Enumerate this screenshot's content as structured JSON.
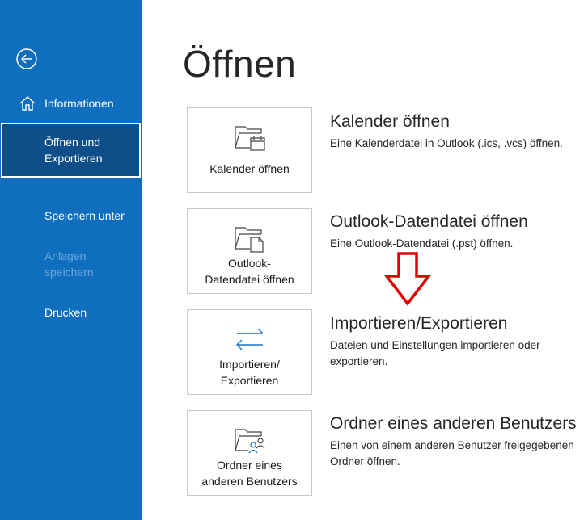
{
  "sidebar": {
    "back_icon": "back-arrow-icon",
    "items": [
      {
        "label": "Informationen",
        "icon": "home-icon"
      },
      {
        "label": "Öffnen und Exportieren",
        "line1": "Öffnen und",
        "line2": "Exportieren",
        "selected": true
      },
      {
        "label": "Speichern unter"
      },
      {
        "label": "Anlagen speichern",
        "line1": "Anlagen",
        "line2": "speichern",
        "disabled": true
      },
      {
        "label": "Drucken"
      }
    ],
    "colors": {
      "background": "#106ebe",
      "selected": "#0e4f8a",
      "disabled_text": "#6aa6de"
    }
  },
  "page": {
    "title": "Öffnen"
  },
  "tiles": [
    {
      "label_line1": "Kalender öffnen",
      "label_line2": "",
      "icon": "calendar-folder-icon",
      "heading": "Kalender öffnen",
      "description": "Eine Kalenderdatei in Outlook (.ics, .vcs) öffnen."
    },
    {
      "label_line1": "Outlook-",
      "label_line2": "Datendatei öffnen",
      "icon": "data-file-folder-icon",
      "heading": "Outlook-Datendatei öffnen",
      "description": "Eine Outlook-Datendatei (.pst) öffnen."
    },
    {
      "label_line1": "Importieren/",
      "label_line2": "Exportieren",
      "icon": "import-export-arrows-icon",
      "heading": "Importieren/Exportieren",
      "description": "Dateien und Einstellungen importieren oder exportieren."
    },
    {
      "label_line1": "Ordner eines",
      "label_line2": "anderen Benutzers",
      "icon": "shared-folder-users-icon",
      "heading": "Ordner eines anderen Benutzers",
      "description": "Einen von einem anderen Benutzer freigegebenen Ordner öffnen."
    }
  ],
  "annotation": {
    "icon": "red-down-arrow-icon",
    "color": "#e00000"
  }
}
